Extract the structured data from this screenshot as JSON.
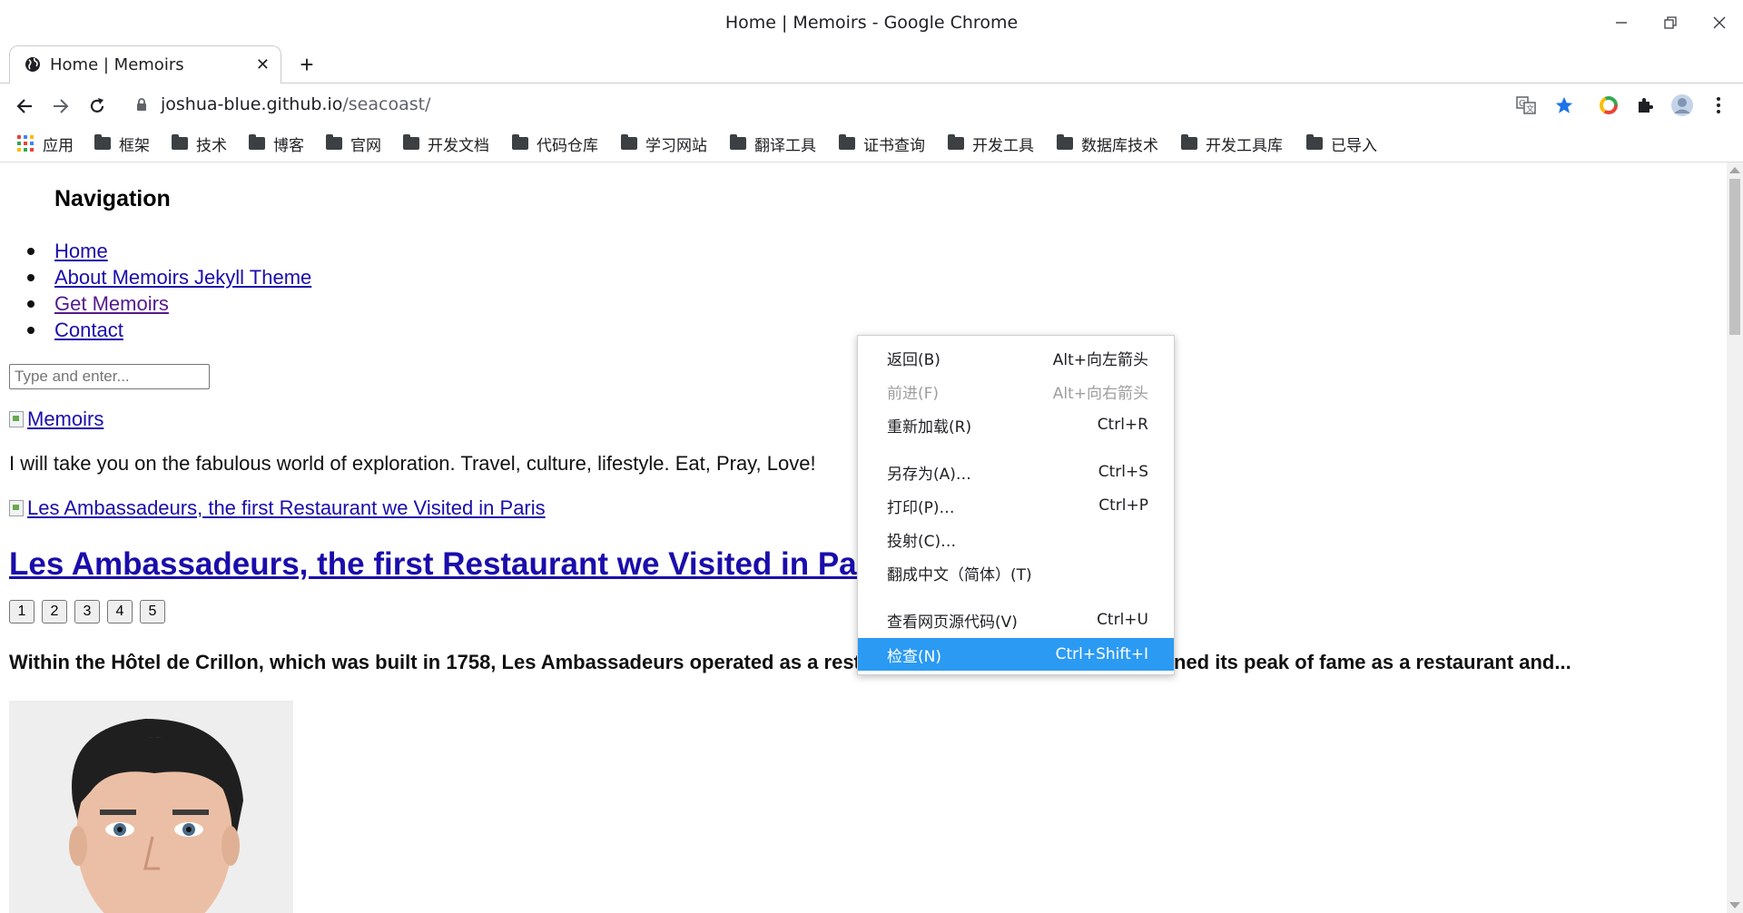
{
  "window": {
    "title": "Home | Memoirs - Google Chrome"
  },
  "tab": {
    "title": "Home | Memoirs",
    "close": "✕",
    "new_tab": "+"
  },
  "address_bar": {
    "host": "joshua-blue.github.io",
    "path": "/seacoast/"
  },
  "bookmarks": [
    {
      "label": "应用",
      "icon": "apps-grid-icon"
    },
    {
      "label": "框架",
      "icon": "folder-icon"
    },
    {
      "label": "技术",
      "icon": "folder-icon"
    },
    {
      "label": "博客",
      "icon": "folder-icon"
    },
    {
      "label": "官网",
      "icon": "folder-icon"
    },
    {
      "label": "开发文档",
      "icon": "folder-icon"
    },
    {
      "label": "代码仓库",
      "icon": "folder-icon"
    },
    {
      "label": "学习网站",
      "icon": "folder-icon"
    },
    {
      "label": "翻译工具",
      "icon": "folder-icon"
    },
    {
      "label": "证书查询",
      "icon": "folder-icon"
    },
    {
      "label": "开发工具",
      "icon": "folder-icon"
    },
    {
      "label": "数据库技术",
      "icon": "folder-icon"
    },
    {
      "label": "开发工具库",
      "icon": "folder-icon"
    },
    {
      "label": "已导入",
      "icon": "folder-icon"
    }
  ],
  "page": {
    "nav_heading": "Navigation",
    "nav_links": [
      "Home",
      "About Memoirs Jekyll Theme",
      "Get Memoirs",
      "Contact"
    ],
    "search_placeholder": "Type and enter...",
    "logo_alt": "Memoirs",
    "tagline": "I will take you on the fabulous world of exploration. Travel, culture, lifestyle. Eat, Pray, Love!",
    "post_image_alt": "Les Ambassadeurs, the first Restaurant we Visited in Paris",
    "post_title": "Les Ambassadeurs, the first Restaurant we Visited in Paris",
    "pages": [
      "1",
      "2",
      "3",
      "4",
      "5"
    ],
    "excerpt_left": "Within the Hôtel de Crillon, which was built in 1758, Les Ambassadeurs operated as a restaurant",
    "excerpt_right": "ned its peak of fame as a restaurant and..."
  },
  "context_menu": {
    "items": [
      {
        "label": "返回(B)",
        "shortcut": "Alt+向左箭头",
        "state": "normal"
      },
      {
        "label": "前进(F)",
        "shortcut": "Alt+向右箭头",
        "state": "disabled"
      },
      {
        "label": "重新加载(R)",
        "shortcut": "Ctrl+R",
        "state": "normal"
      },
      {
        "label": "另存为(A)…",
        "shortcut": "Ctrl+S",
        "state": "normal"
      },
      {
        "label": "打印(P)…",
        "shortcut": "Ctrl+P",
        "state": "normal"
      },
      {
        "label": "投射(C)…",
        "shortcut": "",
        "state": "normal"
      },
      {
        "label": "翻成中文（简体）(T)",
        "shortcut": "",
        "state": "normal"
      },
      {
        "label": "查看网页源代码(V)",
        "shortcut": "Ctrl+U",
        "state": "normal"
      },
      {
        "label": "检查(N)",
        "shortcut": "Ctrl+Shift+I",
        "state": "highlighted"
      }
    ]
  },
  "colors": {
    "link": "#1a0dab",
    "visited_link": "#551a8b",
    "menu_highlight": "#2b9af3",
    "star": "#1a73e8"
  }
}
